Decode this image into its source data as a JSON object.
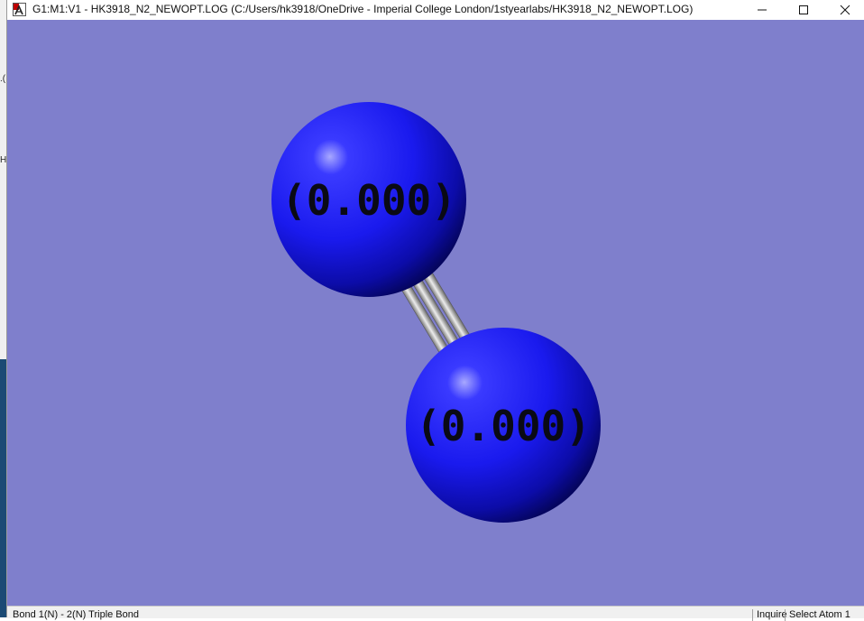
{
  "window": {
    "title": "G1:M1:V1 - HK3918_N2_NEWOPT.LOG (C:/Users/hk3918/OneDrive - Imperial College London/1styearlabs/HK3918_N2_NEWOPT.LOG)",
    "minimize_icon": "minimize-icon",
    "maximize_icon": "maximize-icon",
    "close_icon": "close-icon"
  },
  "viewport": {
    "background_color": "#7f7fcc",
    "atoms": [
      {
        "element": "N",
        "label": "(0.000)"
      },
      {
        "element": "N",
        "label": "(0.000)"
      }
    ],
    "bond": {
      "type": "triple"
    },
    "atom_color": "#1a1aee",
    "bond_color": "#c8c8c8"
  },
  "statusbar": {
    "left_text": "Bond 1(N) - 2(N)  Triple Bond",
    "mode": "Inquire",
    "hint": "Select Atom 1"
  },
  "behind_window": {
    "fragment_top": ".(",
    "fragment_mid": "H"
  }
}
